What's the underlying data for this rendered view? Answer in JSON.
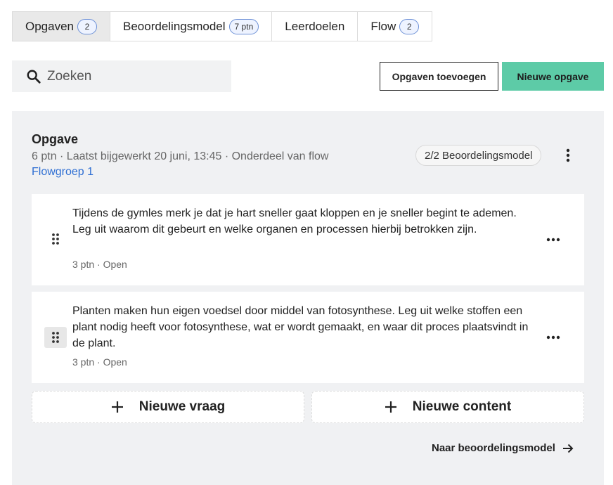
{
  "tabs": [
    {
      "label": "Opgaven",
      "count": "2",
      "active": true
    },
    {
      "label": "Beoordelingsmodel",
      "count": "7 ptn",
      "active": false
    },
    {
      "label": "Leerdoelen",
      "count": "",
      "active": false
    },
    {
      "label": "Flow",
      "count": "2",
      "active": false
    }
  ],
  "search": {
    "placeholder": "Zoeken",
    "icon": "search-icon"
  },
  "toolbar": {
    "add_existing_label": "Opgaven toevoegen",
    "new_label": "Nieuwe opgave",
    "accent_color": "#5dcba7"
  },
  "assignment": {
    "title": "Opgave",
    "meta": "6 ptn · Laatst bijgewerkt 20 juni, 13:45 · Onderdeel van flow",
    "flow_link": "Flowgroep 1",
    "rubric_badge": "2/2 Beoordelingsmodel",
    "questions": [
      {
        "text": "Tijdens de gymles merk je dat je hart sneller gaat kloppen en je sneller begint te ademen. Leg uit waarom dit gebeurt en welke organen en processen hierbij betrokken zijn.",
        "meta": "3 ptn · Open"
      },
      {
        "text": "Planten maken hun eigen voedsel door middel van fotosynthese. Leg uit welke stoffen een plant nodig heeft voor fotosynthese, wat er wordt gemaakt, en waar dit proces plaatsvindt in de plant.",
        "meta": "3 ptn · Open"
      }
    ],
    "add_question_label": "Nieuwe vraag",
    "add_content_label": "Nieuwe content",
    "next_link_label": "Naar beoordelingsmodel"
  }
}
